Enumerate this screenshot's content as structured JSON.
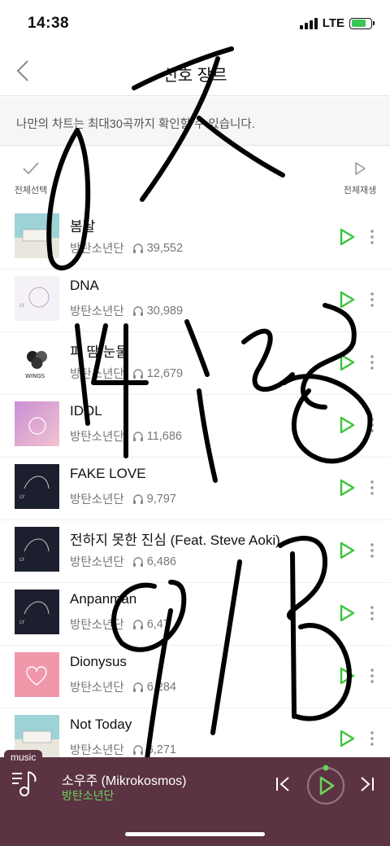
{
  "status": {
    "time": "14:38",
    "network": "LTE"
  },
  "header": {
    "title": "선호 장르"
  },
  "description": "나만의 차트는 최대30곡까지 확인할 수 있습니다.",
  "controls": {
    "select_all": "전체선택",
    "play_all": "전체재생"
  },
  "songs": [
    {
      "title": "봄날",
      "artist": "방탄소년단",
      "plays": "39,552",
      "art": "hyyh"
    },
    {
      "title": "DNA",
      "artist": "방탄소년단",
      "plays": "30,989",
      "art": "ly"
    },
    {
      "title": "피 땀 눈물",
      "artist": "방탄소년단",
      "plays": "12,679",
      "art": "wings"
    },
    {
      "title": "IDOL",
      "artist": "방탄소년단",
      "plays": "11,686",
      "art": "idol"
    },
    {
      "title": "FAKE LOVE",
      "artist": "방탄소년단",
      "plays": "9,797",
      "art": "dark"
    },
    {
      "title": "전하지 못한 진심 (Feat. Steve Aoki)",
      "artist": "방탄소년단",
      "plays": "6,486",
      "art": "dark"
    },
    {
      "title": "Anpanman",
      "artist": "방탄소년단",
      "plays": "6,47",
      "art": "dark"
    },
    {
      "title": "Dionysus",
      "artist": "방탄소년단",
      "plays": "6,284",
      "art": "pink"
    },
    {
      "title": "Not Today",
      "artist": "방탄소년단",
      "plays": "6,271",
      "art": "hyyh"
    }
  ],
  "player": {
    "tab_label": "music",
    "title": "소우주 (Mikrokosmos)",
    "artist": "방탄소년단"
  },
  "colors": {
    "accent": "#3cc43b",
    "player_bg": "#5b3342",
    "artist_green": "#6ad25b"
  }
}
